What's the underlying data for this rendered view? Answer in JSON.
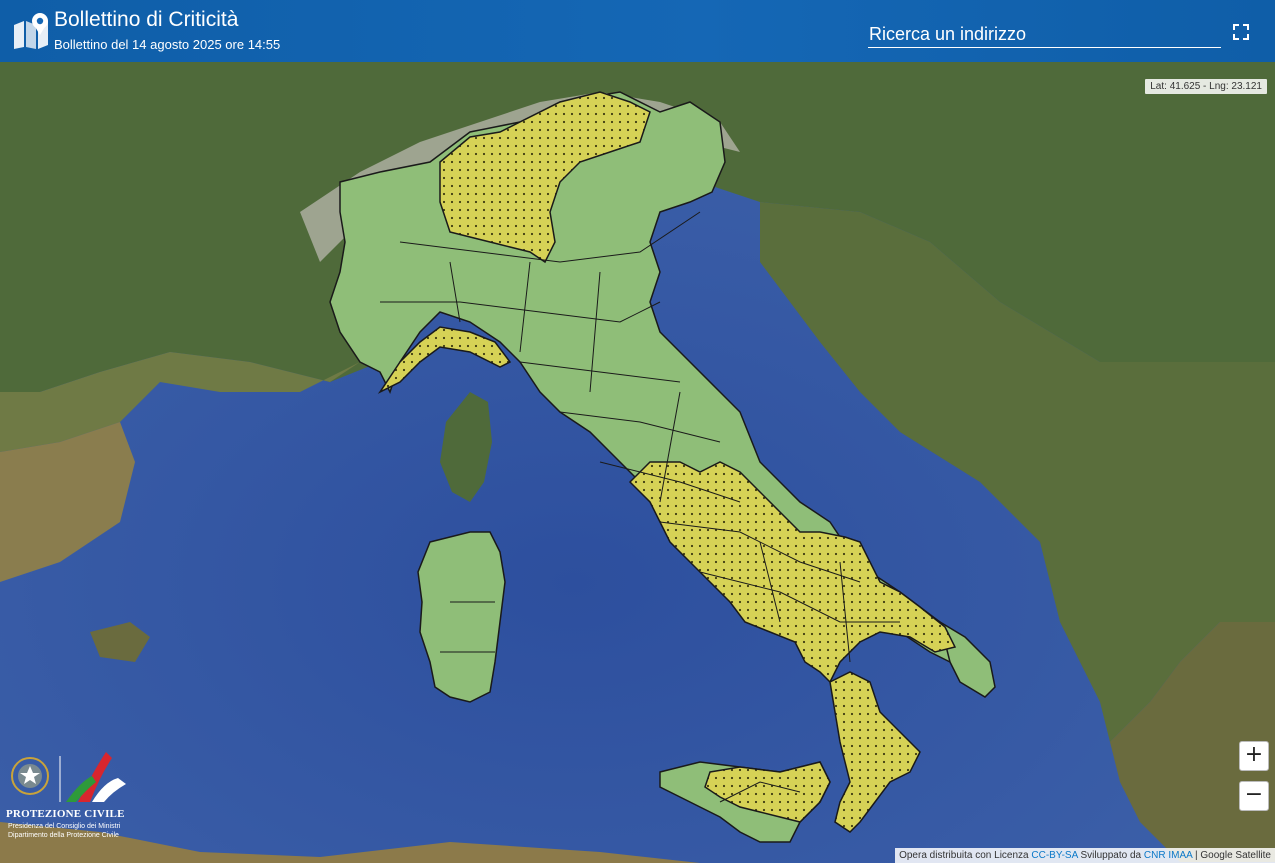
{
  "header": {
    "title": "Bollettino di Criticità",
    "subtitle": "Bollettino del 14 agosto 2025 ore 14:55",
    "search_placeholder": "Ricerca un indirizzo",
    "icons": {
      "logo": "map-pin-icon",
      "fullscreen": "fullscreen-icon"
    }
  },
  "map": {
    "coords": "Lat: 41.625 - Lng: 23.121",
    "zoom_in": "+",
    "zoom_out": "−",
    "legend_colors": {
      "green": "#8fbe78",
      "yellow": "#d6d256",
      "sea": "#3a5fa8"
    }
  },
  "attribution": {
    "prefix": "Opera distribuita con Licenza ",
    "license": "CC-BY-SA",
    "middle": " Sviluppato da ",
    "developer": "CNR IMAA",
    "suffix": " | Google Satellite"
  },
  "footer_logo": {
    "name": "PROTEZIONE CIVILE",
    "line1": "Presidenza del Consiglio dei Ministri",
    "line2": "Dipartimento della Protezione Civile"
  }
}
